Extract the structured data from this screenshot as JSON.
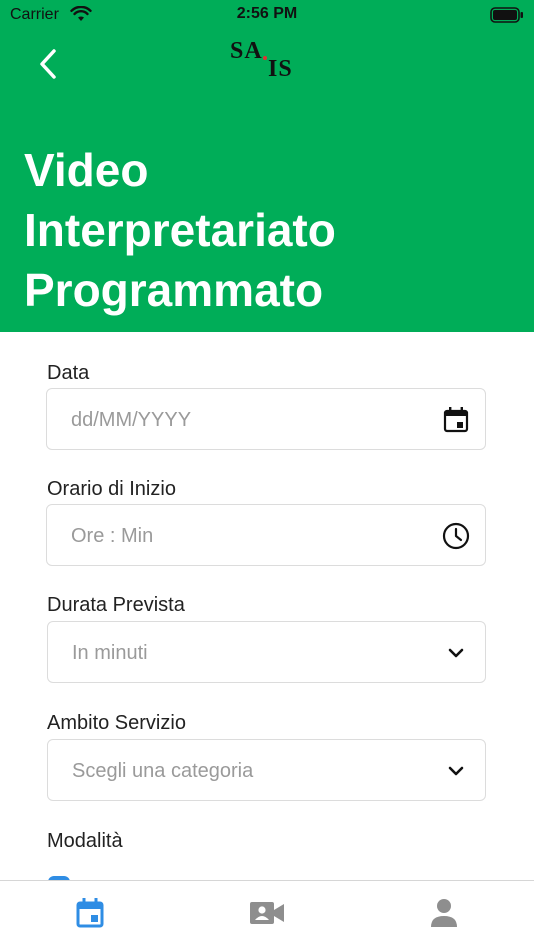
{
  "status_bar": {
    "carrier": "Carrier",
    "time": "2:56 PM"
  },
  "header": {
    "back_icon": "chevron-left-icon",
    "logo": {
      "line1": "SA",
      "line2": "IS"
    },
    "title_lines": [
      "Video",
      "Interpretariato",
      "Programmato"
    ]
  },
  "form": {
    "data": {
      "label": "Data",
      "placeholder": "dd/MM/YYYY",
      "icon": "calendar-icon"
    },
    "orario": {
      "label": "Orario di Inizio",
      "placeholder": "Ore : Min",
      "icon": "clock-icon"
    },
    "durata": {
      "label": "Durata Prevista",
      "placeholder": "In minuti",
      "icon": "chevron-down-icon"
    },
    "ambito": {
      "label": "Ambito Servizio",
      "placeholder": "Scegli una categoria",
      "icon": "chevron-down-icon"
    },
    "modalita": {
      "label": "Modalità"
    }
  },
  "tabbar": {
    "tabs": [
      {
        "icon": "calendar-icon",
        "active": true
      },
      {
        "icon": "video-camera-icon",
        "active": false
      },
      {
        "icon": "person-icon",
        "active": false
      }
    ]
  },
  "colors": {
    "brand": "#00ad58",
    "tab_active": "#2f8de4",
    "tab_inactive": "#8e8e8e"
  }
}
